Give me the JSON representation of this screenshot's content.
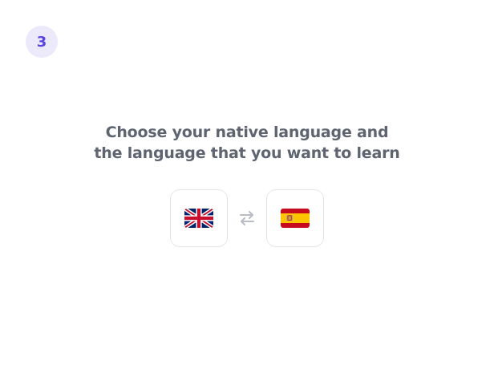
{
  "step": {
    "number": "3"
  },
  "heading": {
    "line1": "Choose your native language and",
    "line2": "the language that you want to learn"
  },
  "native_language": {
    "icon": "uk-flag-icon"
  },
  "target_language": {
    "icon": "spain-flag-icon"
  },
  "swap": {
    "icon": "swap-arrows-icon"
  },
  "colors": {
    "accent": "#5b45e0",
    "badge_bg": "#ece9fb",
    "heading_text": "#5e6470",
    "card_border": "#e3e5e9",
    "icon_gray": "#b8bcc3"
  }
}
